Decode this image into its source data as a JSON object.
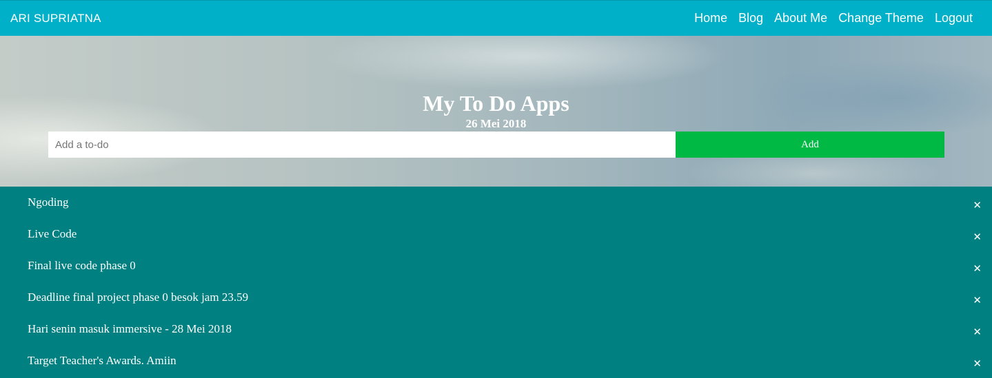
{
  "navbar": {
    "brand": "ARI SUPRIATNA",
    "links": [
      "Home",
      "Blog",
      "About Me",
      "Change Theme",
      "Logout"
    ]
  },
  "hero": {
    "title": "My To Do Apps",
    "date": "26 Mei 2018"
  },
  "form": {
    "placeholder": "Add a to-do",
    "value": "",
    "add_label": "Add"
  },
  "todos": [
    {
      "text": "Ngoding",
      "delete": "✕"
    },
    {
      "text": "Live Code",
      "delete": "✕"
    },
    {
      "text": "Final live code phase 0",
      "delete": "✕"
    },
    {
      "text": "Deadline final project phase 0 besok jam 23.59",
      "delete": "✕"
    },
    {
      "text": "Hari senin masuk immersive - 28 Mei 2018",
      "delete": "✕"
    },
    {
      "text": "Target Teacher's Awards. Amiin",
      "delete": "✕"
    }
  ],
  "colors": {
    "navbar": "#00b0c8",
    "add_button": "#00b944",
    "list_background": "#008080"
  },
  "icons": {
    "delete": "close-icon"
  }
}
